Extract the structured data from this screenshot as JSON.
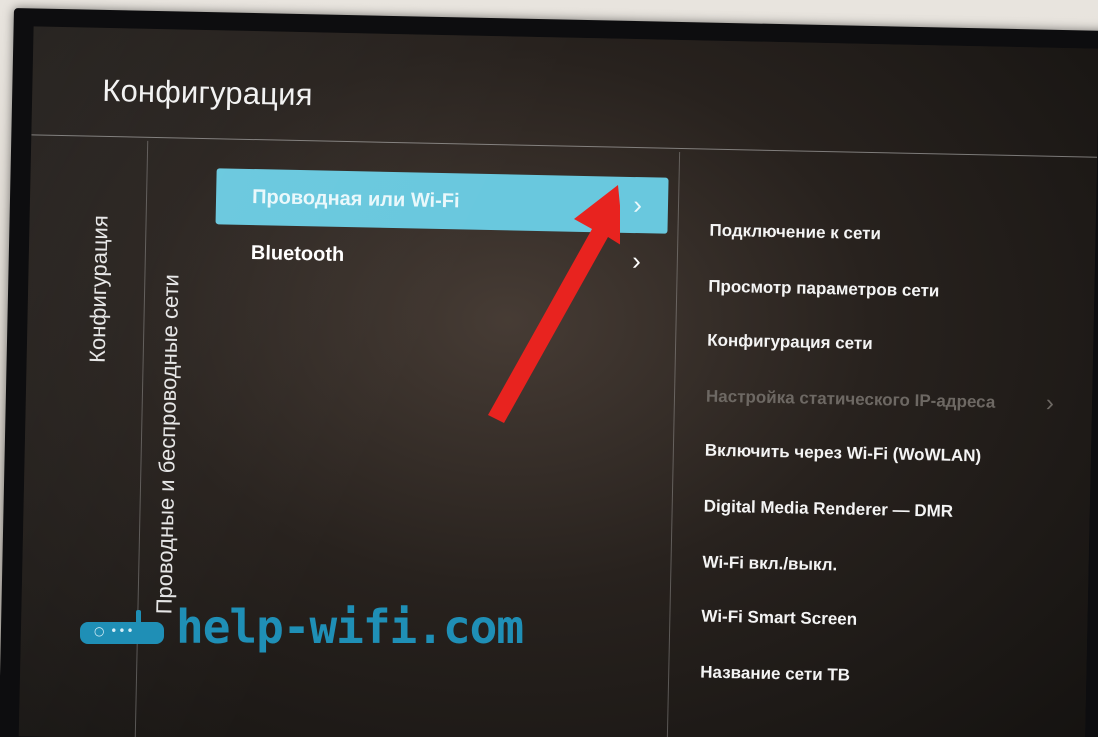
{
  "header": {
    "title": "Конфигурация"
  },
  "breadcrumb": {
    "level1": "Конфигурация",
    "level2": "Проводные и беспроводные сети"
  },
  "middle_menu": {
    "items": [
      {
        "label": "Проводная или Wi-Fi",
        "selected": true,
        "chevron": "›"
      },
      {
        "label": "Bluetooth",
        "selected": false,
        "chevron": "›"
      }
    ]
  },
  "right_menu": {
    "items": [
      {
        "label": "Подключение к сети",
        "enabled": true
      },
      {
        "label": "Просмотр параметров сети",
        "enabled": true
      },
      {
        "label": "Конфигурация сети",
        "enabled": true
      },
      {
        "label": "Настройка статического IP-адреса",
        "enabled": false,
        "chevron": "›"
      },
      {
        "label": "Включить через Wi-Fi (WoWLAN)",
        "enabled": true
      },
      {
        "label": "Digital Media Renderer — DMR",
        "enabled": true
      },
      {
        "label": "Wi-Fi вкл./выкл.",
        "enabled": true
      },
      {
        "label": "Wi-Fi Smart Screen",
        "enabled": true
      },
      {
        "label": "Название сети ТВ",
        "enabled": true
      }
    ]
  },
  "annotation": {
    "icon": "red-arrow-icon",
    "color": "#e8231f"
  },
  "watermark": {
    "text": "help-wifi.com",
    "icon": "router-icon",
    "router_dots": "○ •••",
    "color": "#1f8fb6"
  },
  "colors": {
    "selection": "#69c8de",
    "disabled_text": "#6d6863",
    "text": "#f4f4f4"
  }
}
